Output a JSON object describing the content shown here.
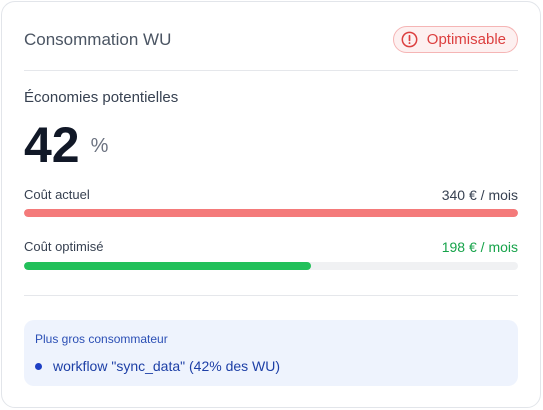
{
  "card": {
    "title": "Consommation WU",
    "badge": {
      "label": "Optimisable",
      "icon": "alert-circle-icon",
      "color": "#dc3f3f"
    }
  },
  "savings": {
    "label": "Économies potentielles",
    "value": "42",
    "unit": "%"
  },
  "costs": [
    {
      "label": "Coût actuel",
      "value": "340 € / mois",
      "fill_fraction": 1.0,
      "color": "#f47a7a"
    },
    {
      "label": "Coût optimisé",
      "value": "198 € / mois",
      "fill_fraction": 0.58,
      "color": "#22c05a"
    }
  ],
  "top_consumer": {
    "title": "Plus gros consommateur",
    "item": "workflow \"sync_data\" (42% des WU)"
  }
}
